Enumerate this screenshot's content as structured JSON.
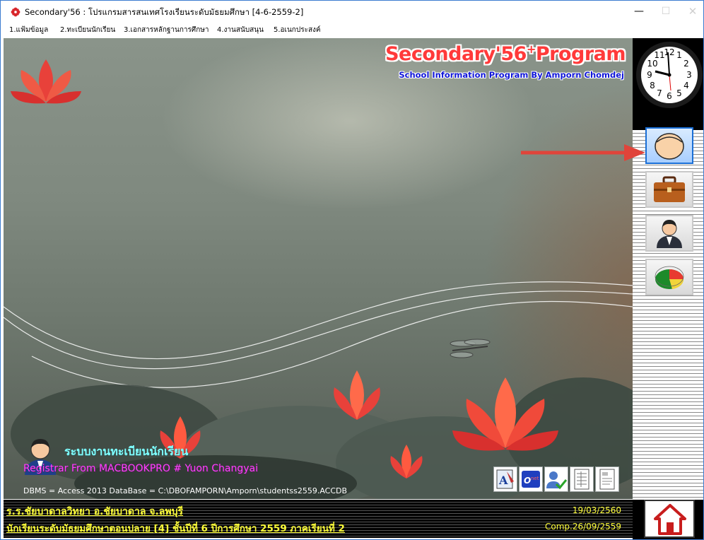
{
  "window": {
    "title": "Secondary'56 : โปรแกรมสารสนเทศโรงเรียนระดับมัธยมศึกษา [4-6-2559-2]",
    "app_icon": "red-flower-icon",
    "minimize_glyph": "—",
    "maximize_glyph": "☐",
    "close_glyph": "✕"
  },
  "menu": {
    "items": [
      "1.แฟ้มข้อมูล",
      "2.ทะเบียนนักเรียน",
      "3.เอกสารหลักฐานการศึกษา",
      "4.งานสนับสนุน",
      "5.อเนกประสงค์"
    ]
  },
  "banner": {
    "title": "Secondary'56",
    "title_sup": "+",
    "title_suffix": "Program",
    "subtitle": "School Information Program By Amporn Chomdej"
  },
  "module": {
    "title": "ระบบงานทะเบียนนักเรียน",
    "registrar": "Registrar From MACBOOKPRO # Yuon Changyai",
    "dbms": "DBMS = Access 2013  DataBase = C:\\DBOFAMPORN\\Amporn\\studentss2559.ACCDB"
  },
  "quick_icons": [
    "word-document-icon",
    "o-net-icon",
    "user-check-icon",
    "form-sheet-icon",
    "report-sheet-icon"
  ],
  "right_panel": {
    "buttons": [
      {
        "name": "student-face-icon",
        "active": true
      },
      {
        "name": "briefcase-icon",
        "active": false
      },
      {
        "name": "teacher-icon",
        "active": false
      },
      {
        "name": "pie-chart-icon",
        "active": false
      }
    ]
  },
  "status": {
    "school": "ร.ร.ชัยบาดาลวิทยา  อ.ชัยบาดาล  จ.ลพบุรี",
    "class_info": "นักเรียนระดับมัธยมศึกษาตอนปลาย [4]  ชั้นปีที่ 6  ปีการศึกษา 2559  ภาคเรียนที่  2",
    "date": "19/03/2560",
    "comp": "Comp.26/09/2559"
  },
  "colors": {
    "title_red": "#ff3a3a",
    "subtitle_blue": "#1016d8",
    "module_cyan": "#7fffff",
    "registrar_magenta": "#ff40ff",
    "status_yellow": "#ffff3a",
    "arrow_red": "#e0443a",
    "active_blue": "#1a6fd6"
  }
}
